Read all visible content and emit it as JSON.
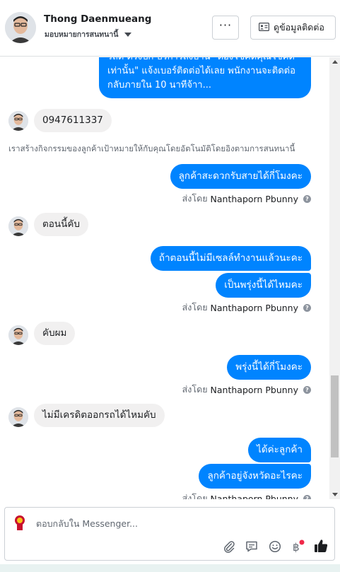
{
  "header": {
    "name": "Thong Daenmueang",
    "assign_label": "มอบหมายการสนทนานี้",
    "more_label": "···",
    "contact_label": "ดูข้อมูลติดต่อ"
  },
  "thread": {
    "first_bubble_lines": [
      "รถดี ตรงปก บริการถึงบ้าน \"ต้องโชคดีคุณโชคดี",
      "เท่านั้น\" แจ้งเบอร์ติดต่อได้เลย พนักงานจะติดต่อ",
      "กลับภายใน 10 นาทีจ้าา..."
    ],
    "msg_phone": "0947611337",
    "system_note": "เราสร้างกิจกรรมของลูกค้าเป้าหมายให้กับคุณโดยอัตโนมัติโดยอิงตามการสนทนานี้",
    "msg_out_1": "ลูกค้าสะดวกรับสายได้กี่โมงคะ",
    "sent_by_prefix": "ส่งโดย",
    "sent_by_name": "Nanthaporn Pbunny",
    "msg_in_2": "ตอนนี้คับ",
    "msg_out_2": "ถ้าตอนนี้ไม่มีเซลล์ทำงานแล้วนะคะ",
    "msg_out_3": "เป็นพรุ่งนี้ได้ไหมคะ",
    "msg_in_3": "คับผม",
    "msg_out_4": "พรุ่งนี้ได้กี่โมงคะ",
    "msg_in_4": "ไม่มีเครดิตออกรถได้ไหมคับ",
    "msg_out_5": "ได้ค่ะลูกค้า",
    "msg_out_6": "ลูกค้าอยู่จังหวัดอะไรคะ"
  },
  "composer": {
    "placeholder": "ตอบกลับใน Messenger..."
  },
  "colors": {
    "messenger_blue": "#0084ff",
    "incoming_gray": "#f1f0f0",
    "notification_dot": "#f02849"
  },
  "icons": [
    "more-dots-icon",
    "contact-card-icon",
    "help-icon",
    "paperclip-icon",
    "saved-reply-icon",
    "emoji-icon",
    "baht-payment-icon",
    "thumbs-up-icon"
  ]
}
